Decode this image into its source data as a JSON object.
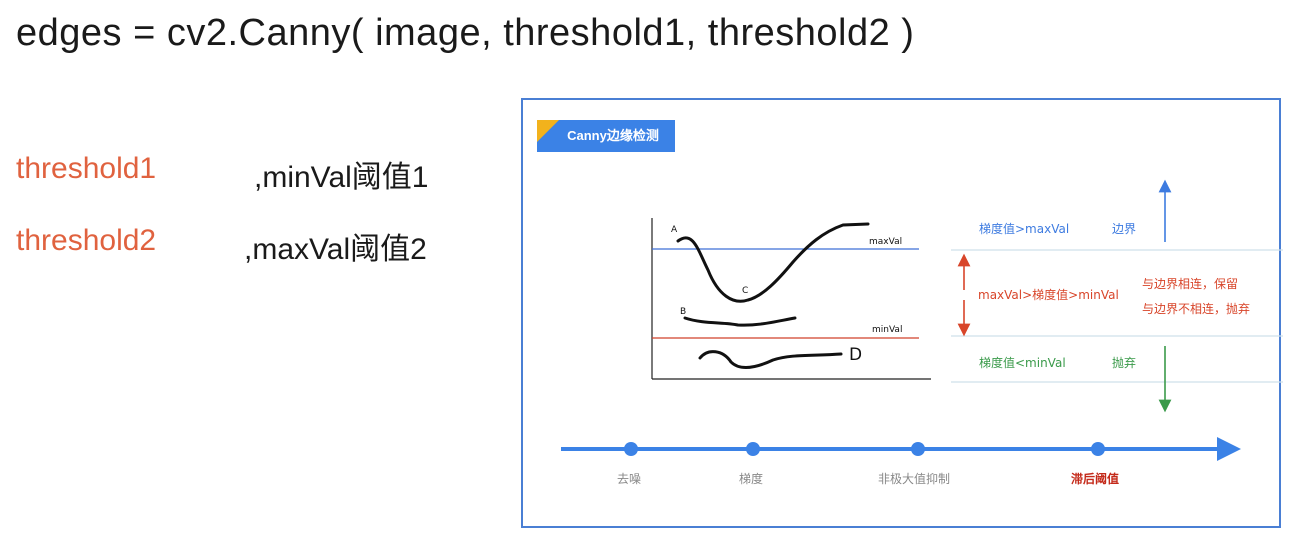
{
  "code": "edges = cv2.Canny( image, threshold1, threshold2 )",
  "params": [
    {
      "name": "threshold1",
      "desc": ",minVal阈值1"
    },
    {
      "name": "threshold2",
      "desc": ",maxVal阈值2"
    }
  ],
  "panel": {
    "title": "Canny边缘检测",
    "curve_labels": {
      "a": "A",
      "b": "B",
      "c": "C",
      "d": "D"
    },
    "line_labels": {
      "max": "maxVal",
      "min": "minVal"
    },
    "rules": {
      "top_condition": "梯度值>maxVal",
      "top_result": "边界",
      "mid_condition": "maxVal>梯度值>minVal",
      "mid_result_1": "与边界相连，保留",
      "mid_result_2": "与边界不相连，抛弃",
      "bottom_condition": "梯度值<minVal",
      "bottom_result": "抛弃"
    },
    "steps": [
      "去噪",
      "梯度",
      "非极大值抑制",
      "滞后阈值"
    ],
    "colors": {
      "blue": "#3d7be0",
      "red": "#d8452a",
      "green": "#3a9a4a",
      "accent": "#f2b21c"
    }
  }
}
